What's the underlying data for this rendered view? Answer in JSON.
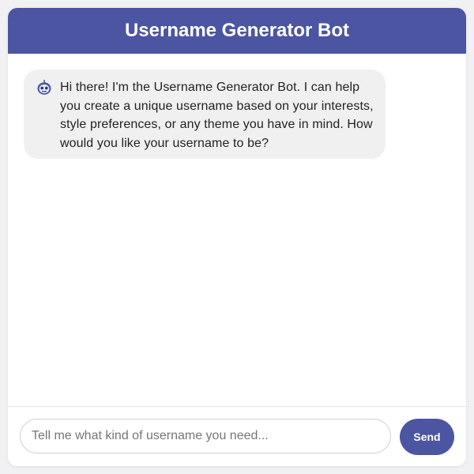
{
  "header": {
    "title": "Username Generator Bot"
  },
  "messages": [
    {
      "sender": "bot",
      "avatar_icon": "robot-icon",
      "text": "Hi there! I'm the Username Generator Bot. I can help you create a unique username based on your interests, style preferences, or any theme you have in mind. How would you like your username to be?"
    }
  ],
  "composer": {
    "placeholder": "Tell me what kind of username you need...",
    "value": "",
    "send_label": "Send"
  },
  "colors": {
    "accent": "#4b55a2",
    "bubble_bg": "#f0f0f0",
    "page_bg": "#f1f1f4"
  }
}
